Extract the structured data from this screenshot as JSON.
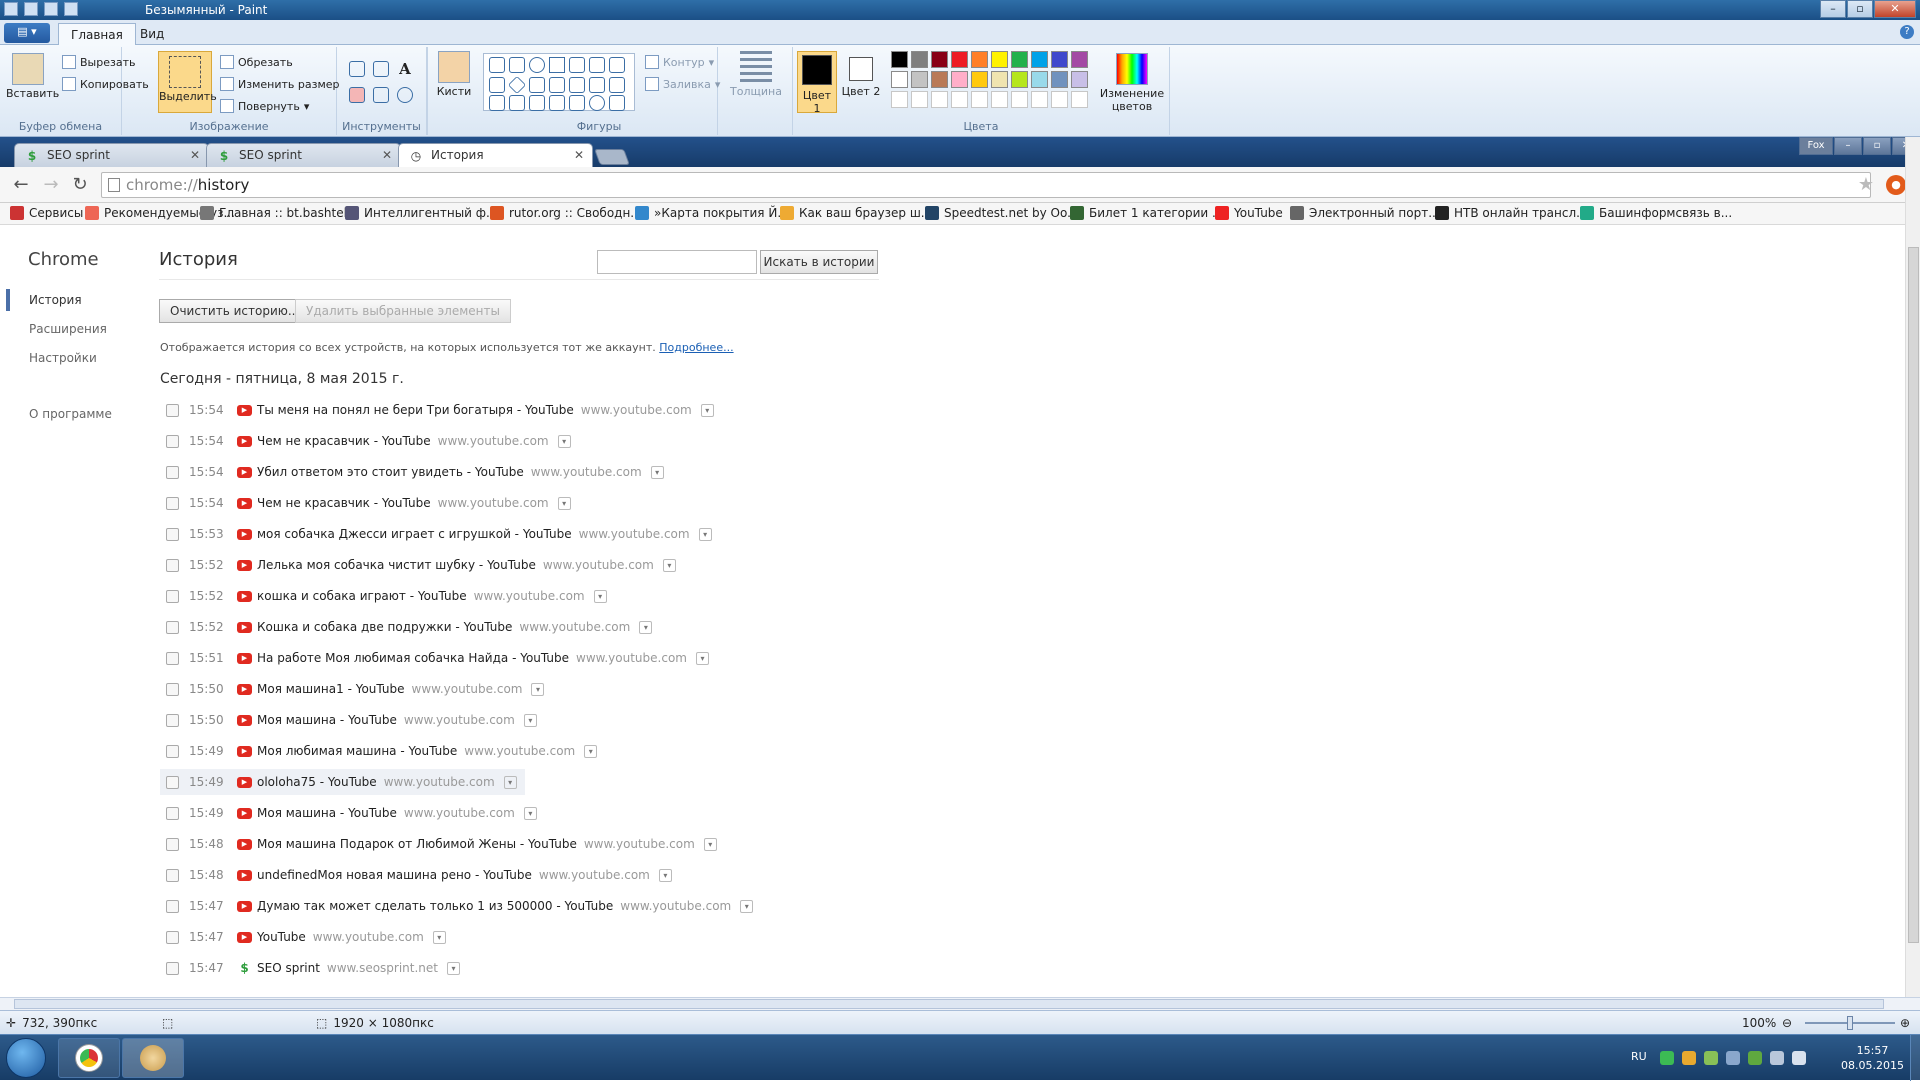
{
  "paint": {
    "title": "Безымянный - Paint",
    "tabs": [
      "Главная",
      "Вид"
    ],
    "clipboard": {
      "paste": "Вставить",
      "cut": "Вырезать",
      "copy": "Копировать",
      "group": "Буфер обмена"
    },
    "image": {
      "select": "Выделить",
      "crop": "Обрезать",
      "resize": "Изменить размер",
      "rotate": "Повернуть",
      "group": "Изображение"
    },
    "tools": {
      "group": "Инструменты"
    },
    "brushes": {
      "label": "Кисти"
    },
    "shapes": {
      "outline": "Контур",
      "fill": "Заливка",
      "group": "Фигуры"
    },
    "size": {
      "label": "Толщина"
    },
    "colors": {
      "color1": "Цвет 1",
      "color2": "Цвет 2",
      "edit": "Изменение цветов",
      "group": "Цвета",
      "palette_row1": [
        "#000000",
        "#7f7f7f",
        "#880015",
        "#ed1c24",
        "#ff7f27",
        "#fff200",
        "#22b14c",
        "#00a2e8",
        "#3f48cc",
        "#a349a4"
      ],
      "palette_row2": [
        "#ffffff",
        "#c3c3c3",
        "#b97a57",
        "#ffaec9",
        "#ffc90e",
        "#efe4b0",
        "#b5e61d",
        "#99d9ea",
        "#7092be",
        "#c8bfe7"
      ]
    },
    "status": {
      "cursor": "732, 390пкс",
      "canvas_size": "1920 × 1080пкс",
      "zoom": "100%",
      "zoom_fraction": 0.5
    }
  },
  "browser": {
    "tabs": [
      {
        "title": "SEO sprint",
        "icon": "seo-sprint-icon"
      },
      {
        "title": "SEO sprint",
        "icon": "seo-sprint-icon"
      },
      {
        "title": "История",
        "icon": "history-icon"
      }
    ],
    "window_label": "Fox",
    "url_scheme": "chrome://",
    "url_path": "history",
    "bookmarks": [
      "Сервисы",
      "Рекомендуемые уз...",
      "Главная :: bt.bashtel...",
      "Интеллигентный ф...",
      "rutor.org :: Свободн...",
      "»Карта покрытия Й...",
      "Как ваш браузер ш...",
      "Speedtest.net by Oo...",
      "Билет 1 категории ...",
      "YouTube",
      "Электронный порт...",
      "НТВ онлайн трансл...",
      "Башинформсвязь в..."
    ]
  },
  "history": {
    "sidebar_title": "Chrome",
    "nav": [
      "История",
      "Расширения",
      "Настройки",
      "О программе"
    ],
    "title": "История",
    "search_button": "Искать в истории",
    "clear_button": "Очистить историю...",
    "delete_button": "Удалить выбранные элементы",
    "info_text": "Отображается история со всех устройств, на которых используется тот же аккаунт.",
    "info_link": "Подробнее...",
    "day": "Сегодня - пятница, 8 мая 2015 г.",
    "entries": [
      {
        "time": "15:54",
        "title": "Ты меня на понял не бери Три богатыря - YouTube",
        "domain": "www.youtube.com"
      },
      {
        "time": "15:54",
        "title": "Чем не красавчик - YouTube",
        "domain": "www.youtube.com"
      },
      {
        "time": "15:54",
        "title": "Убил ответом это стоит увидеть - YouTube",
        "domain": "www.youtube.com"
      },
      {
        "time": "15:54",
        "title": "Чем не красавчик - YouTube",
        "domain": "www.youtube.com"
      },
      {
        "time": "15:53",
        "title": "моя собачка Джесси играет с игрушкой - YouTube",
        "domain": "www.youtube.com"
      },
      {
        "time": "15:52",
        "title": "Лелька моя собачка чистит шубку - YouTube",
        "domain": "www.youtube.com"
      },
      {
        "time": "15:52",
        "title": "кошка и собака играют - YouTube",
        "domain": "www.youtube.com"
      },
      {
        "time": "15:52",
        "title": "Кошка и собака две подружки - YouTube",
        "domain": "www.youtube.com"
      },
      {
        "time": "15:51",
        "title": "На работе Моя любимая собачка Найда - YouTube",
        "domain": "www.youtube.com"
      },
      {
        "time": "15:50",
        "title": "Моя машина1 - YouTube",
        "domain": "www.youtube.com"
      },
      {
        "time": "15:50",
        "title": "Моя машина - YouTube",
        "domain": "www.youtube.com"
      },
      {
        "time": "15:49",
        "title": "Моя любимая машина - YouTube",
        "domain": "www.youtube.com"
      },
      {
        "time": "15:49",
        "title": "ololoha75 - YouTube",
        "domain": "www.youtube.com",
        "highlighted": true
      },
      {
        "time": "15:49",
        "title": "Моя машина - YouTube",
        "domain": "www.youtube.com"
      },
      {
        "time": "15:48",
        "title": "Моя машина Подарок от Любимой Жены - YouTube",
        "domain": "www.youtube.com"
      },
      {
        "time": "15:48",
        "title": "undefinedМоя новая машина рено - YouTube",
        "domain": "www.youtube.com"
      },
      {
        "time": "15:47",
        "title": "Думаю так может сделать только 1 из 500000 - YouTube",
        "domain": "www.youtube.com"
      },
      {
        "time": "15:47",
        "title": "YouTube",
        "domain": "www.youtube.com"
      },
      {
        "time": "15:47",
        "title": "SEO sprint",
        "domain": "www.seosprint.net",
        "icon": "seo"
      }
    ]
  },
  "taskbar": {
    "lang": "RU",
    "time": "15:57",
    "date": "08.05.2015"
  }
}
